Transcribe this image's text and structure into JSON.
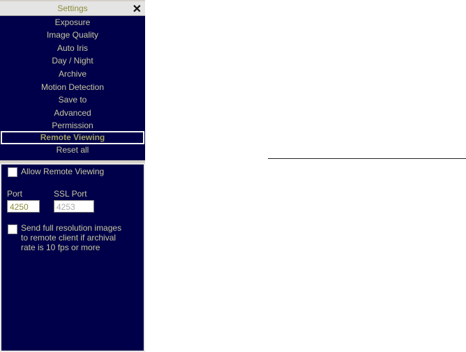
{
  "title": "Settings",
  "menu": [
    "Exposure",
    "Image Quality",
    "Auto Iris",
    "Day / Night",
    "Archive",
    "Motion Detection",
    "Save to",
    "Advanced",
    "Permission",
    "Remote Viewing",
    "Reset all"
  ],
  "selected_index": 9,
  "remote": {
    "allow_label": "Allow Remote Viewing",
    "allow_checked": false,
    "port_label": "Port",
    "port_value": "4250",
    "ssl_label": "SSL Port",
    "ssl_value": "4253",
    "full_res_label_1": "Send full resolution images",
    "full_res_label_2": "to remote client if archival",
    "full_res_label_3": "rate is 10 fps or more",
    "full_res_checked": false
  },
  "colors": {
    "panel": "#00004a",
    "text": "#c8c8a0"
  }
}
